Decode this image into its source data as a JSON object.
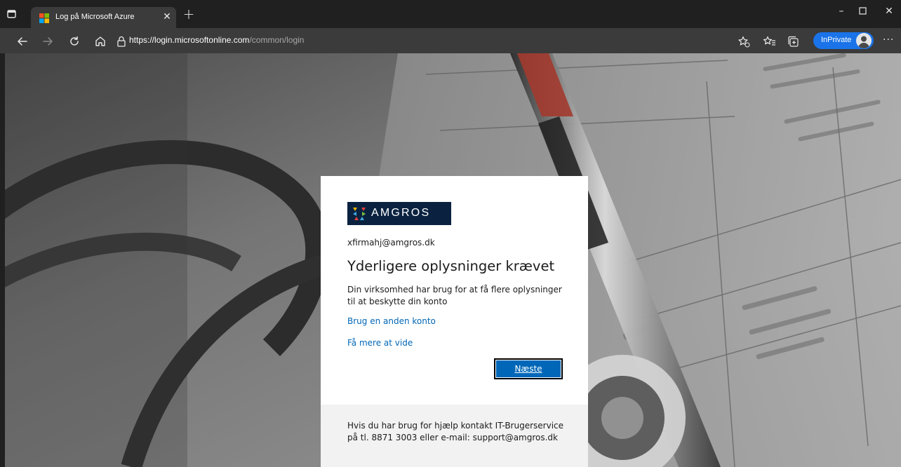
{
  "browser": {
    "tab_title": "Log på Microsoft Azure",
    "url_scheme": "https://",
    "url_host": "login.microsoftonline.com",
    "url_path": "/common/login",
    "inprivate_label": "InPrivate"
  },
  "card": {
    "brand_name": "AMGROS",
    "email": "xfirmahj@amgros.dk",
    "heading": "Yderligere oplysninger krævet",
    "description": "Din virksomhed har brug for at få flere oplysninger til at beskytte din konto",
    "other_account_link": "Brug en anden konto",
    "learn_more_link": "Få mere at vide",
    "next_button": "Næste",
    "help_text": "Hvis du har brug for hjælp kontakt IT-Brugerservice på tl. 8871 3003 eller e-mail: support@amgros.dk"
  },
  "colors": {
    "link": "#0067b8",
    "button": "#0067b8",
    "brand_bg": "#0a2240",
    "inprivate_pill": "#1a73e8"
  }
}
